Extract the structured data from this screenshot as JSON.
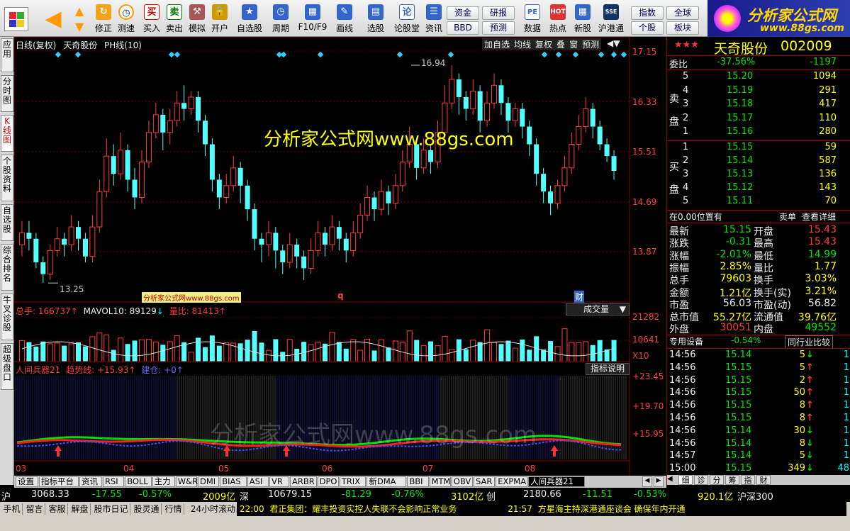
{
  "toolbar": {
    "buttons": [
      "修正",
      "测速",
      "买入",
      "卖出",
      "模拟",
      "开户",
      "自选股",
      "周期",
      "F10/F9",
      "画线",
      "选股",
      "论股堂",
      "资讯",
      "数据",
      "热点",
      "新股",
      "沪港通"
    ],
    "small": [
      "资金",
      "BBD",
      "研报",
      "预测",
      "指数",
      "个股",
      "全球",
      "板块"
    ],
    "logo_text": "分析家公式网",
    "logo_url": "www.88gs.com"
  },
  "vtabs": [
    "应用",
    "分时图",
    "K线图",
    "个股资料",
    "自选股",
    "综合排名",
    "牛叉诊股",
    "超级盘口"
  ],
  "chart": {
    "header": [
      "日线(复权)",
      "天奇股份",
      "PH线(10)"
    ],
    "header_buttons": [
      "加自选",
      "均线",
      "复权",
      "叠",
      "窗",
      "预测"
    ],
    "watermark": "分析家公式网www.88gs.com",
    "watermark_small": "分析家公式网www.88gs.com",
    "watermark_bottom": "分析家公式网www.88gs.com",
    "price_axis": [
      "17.15",
      "16.33",
      "15.51",
      "14.69",
      "13.87"
    ],
    "high_label": "16.94",
    "low_label": "13.25",
    "marker_q": "q",
    "marker_cai": "财",
    "vol_header": {
      "total": "总手: 166737",
      "mavol": "MAVOL10: 89129",
      "ratio": "量比: 81413"
    },
    "vol_button": "成交量",
    "vol_axis": [
      "21282",
      "10641",
      "X10"
    ],
    "ind_header": {
      "name": "人间兵器21",
      "trend": "趋势线: +15.93",
      "build": "建仓: +0"
    },
    "ind_button": "指标说明",
    "ind_axis": [
      "+23.45",
      "+19.70",
      "+15.95"
    ],
    "months": [
      "03",
      "04",
      "05",
      "06",
      "07",
      "08"
    ]
  },
  "chart_data": {
    "type": "candlestick",
    "ylim": [
      13.0,
      17.3
    ],
    "candles": [
      [
        13.9,
        14.1,
        13.7,
        14.3
      ],
      [
        14.1,
        14.0,
        13.8,
        14.3
      ],
      [
        14.0,
        13.6,
        13.5,
        14.1
      ],
      [
        13.6,
        13.4,
        13.25,
        13.7
      ],
      [
        13.4,
        13.8,
        13.3,
        13.9
      ],
      [
        13.8,
        14.0,
        13.7,
        14.2
      ],
      [
        14.0,
        13.9,
        13.7,
        14.1
      ],
      [
        13.9,
        14.2,
        13.8,
        14.4
      ],
      [
        14.2,
        14.0,
        13.8,
        14.3
      ],
      [
        14.0,
        13.7,
        13.6,
        14.1
      ],
      [
        13.7,
        14.2,
        13.6,
        14.4
      ],
      [
        14.2,
        14.8,
        14.1,
        15.0
      ],
      [
        14.8,
        15.4,
        14.7,
        15.7
      ],
      [
        15.4,
        15.1,
        14.9,
        15.6
      ],
      [
        15.1,
        15.5,
        15.0,
        15.8
      ],
      [
        15.5,
        15.0,
        14.8,
        15.6
      ],
      [
        15.0,
        14.7,
        14.5,
        15.2
      ],
      [
        14.7,
        15.3,
        14.6,
        15.5
      ],
      [
        15.3,
        15.8,
        15.2,
        16.0
      ],
      [
        15.8,
        16.1,
        15.7,
        16.3
      ],
      [
        16.1,
        15.8,
        15.5,
        16.2
      ],
      [
        15.8,
        16.0,
        15.6,
        16.2
      ],
      [
        16.0,
        16.3,
        15.9,
        16.5
      ],
      [
        16.3,
        16.2,
        16.0,
        16.6
      ],
      [
        16.2,
        16.4,
        16.1,
        16.5
      ],
      [
        16.4,
        16.0,
        15.8,
        16.5
      ],
      [
        16.0,
        15.6,
        15.4,
        16.1
      ],
      [
        15.6,
        15.0,
        14.8,
        15.7
      ],
      [
        15.0,
        14.7,
        14.5,
        15.1
      ],
      [
        14.7,
        14.9,
        14.6,
        15.1
      ],
      [
        14.9,
        15.2,
        14.8,
        15.4
      ],
      [
        15.2,
        14.9,
        14.6,
        15.3
      ],
      [
        14.9,
        14.5,
        14.3,
        15.0
      ],
      [
        14.5,
        14.0,
        13.8,
        14.6
      ],
      [
        14.0,
        13.9,
        13.6,
        14.1
      ],
      [
        13.9,
        14.1,
        13.7,
        14.3
      ],
      [
        14.1,
        13.8,
        13.5,
        14.2
      ],
      [
        13.8,
        13.6,
        13.4,
        13.9
      ],
      [
        13.6,
        13.9,
        13.5,
        14.1
      ],
      [
        13.9,
        13.7,
        13.5,
        14.0
      ],
      [
        13.7,
        13.5,
        13.3,
        13.8
      ],
      [
        13.5,
        13.8,
        13.4,
        14.0
      ],
      [
        13.8,
        14.1,
        13.7,
        14.3
      ],
      [
        14.1,
        13.9,
        13.7,
        14.2
      ],
      [
        13.9,
        14.2,
        13.8,
        14.4
      ],
      [
        14.2,
        14.0,
        13.8,
        14.3
      ],
      [
        14.0,
        13.8,
        13.6,
        14.1
      ],
      [
        13.8,
        14.1,
        13.7,
        14.3
      ],
      [
        14.1,
        14.4,
        14.0,
        14.6
      ],
      [
        14.4,
        14.7,
        14.3,
        14.9
      ],
      [
        14.7,
        14.5,
        14.3,
        14.8
      ],
      [
        14.5,
        14.8,
        14.4,
        15.0
      ],
      [
        14.8,
        14.6,
        14.4,
        14.9
      ],
      [
        14.6,
        14.9,
        14.5,
        15.1
      ],
      [
        14.9,
        15.3,
        14.8,
        15.5
      ],
      [
        15.3,
        15.6,
        15.2,
        15.9
      ],
      [
        15.6,
        15.2,
        15.0,
        15.7
      ],
      [
        15.2,
        15.5,
        15.1,
        15.7
      ],
      [
        15.5,
        15.3,
        15.1,
        15.6
      ],
      [
        15.3,
        15.8,
        15.2,
        16.0
      ],
      [
        15.8,
        16.3,
        15.7,
        16.6
      ],
      [
        16.3,
        16.7,
        16.2,
        16.94
      ],
      [
        16.7,
        16.4,
        16.1,
        16.8
      ],
      [
        16.4,
        16.2,
        16.0,
        16.5
      ],
      [
        16.2,
        16.5,
        16.1,
        16.7
      ],
      [
        16.5,
        16.0,
        15.8,
        16.6
      ],
      [
        16.0,
        16.3,
        15.9,
        16.5
      ],
      [
        16.3,
        16.6,
        16.2,
        16.8
      ],
      [
        16.6,
        16.3,
        16.1,
        16.7
      ],
      [
        16.3,
        16.0,
        15.8,
        16.4
      ],
      [
        16.0,
        16.2,
        15.9,
        16.3
      ],
      [
        16.2,
        15.9,
        15.7,
        16.3
      ],
      [
        15.9,
        15.6,
        15.4,
        16.0
      ],
      [
        15.6,
        15.1,
        14.9,
        15.7
      ],
      [
        15.1,
        14.8,
        14.6,
        15.2
      ],
      [
        14.8,
        14.6,
        14.4,
        14.9
      ],
      [
        14.6,
        14.9,
        14.5,
        15.0
      ],
      [
        14.9,
        15.2,
        14.8,
        15.4
      ],
      [
        15.2,
        15.6,
        15.1,
        15.8
      ],
      [
        15.6,
        15.9,
        15.5,
        16.1
      ],
      [
        15.9,
        16.2,
        15.8,
        16.4
      ],
      [
        16.2,
        15.9,
        15.7,
        16.3
      ],
      [
        15.9,
        15.6,
        15.5,
        16.0
      ],
      [
        15.6,
        15.4,
        15.3,
        15.7
      ],
      [
        15.4,
        15.15,
        15.0,
        15.5
      ]
    ]
  },
  "right": {
    "stock": "天奇股份",
    "code": "002009",
    "weibi": {
      "label": "委比",
      "pct": "-37.56%",
      "diff": "-1197"
    },
    "sell_label": [
      "卖",
      "盘"
    ],
    "sells": [
      [
        "5",
        "15.20",
        "1094"
      ],
      [
        "4",
        "15.19",
        "291"
      ],
      [
        "3",
        "15.18",
        "417"
      ],
      [
        "2",
        "15.17",
        "110"
      ],
      [
        "1",
        "15.16",
        "280"
      ]
    ],
    "buy_label": [
      "买",
      "盘"
    ],
    "buys": [
      [
        "1",
        "15.15",
        "59"
      ],
      [
        "2",
        "15.14",
        "587"
      ],
      [
        "3",
        "15.13",
        "136"
      ],
      [
        "4",
        "15.12",
        "143"
      ],
      [
        "5",
        "15.11",
        "70"
      ]
    ],
    "position": "在0.00位置有",
    "sell_single": "卖单",
    "detail": "查看详细",
    "quote": [
      [
        "最新",
        "15.15",
        "开盘",
        "15.43"
      ],
      [
        "涨跌",
        "-0.31",
        "最高",
        "15.43"
      ],
      [
        "涨幅",
        "-2.01%",
        "最低",
        "14.99"
      ],
      [
        "振幅",
        "2.85%",
        "量比",
        "1.77"
      ],
      [
        "总手",
        "79603",
        "换手",
        "3.03%"
      ],
      [
        "金额",
        "1.21亿",
        "换手(实)",
        "3.21%"
      ],
      [
        "市盈",
        "56.03",
        "市盈(动)",
        "56.82"
      ],
      [
        "总市值",
        "55.27亿",
        "流通值",
        "39.76亿"
      ],
      [
        "外盘",
        "30051",
        "内盘",
        "49552"
      ]
    ],
    "equip": "专用设备",
    "equip_pct": "-0.54%",
    "compare": "同行业比较",
    "ticks": [
      [
        "14:56",
        "15.14",
        "5",
        "1"
      ],
      [
        "14:56",
        "15.15",
        "5",
        "1"
      ],
      [
        "14:56",
        "15.15",
        "2",
        "1"
      ],
      [
        "14:56",
        "15.15",
        "50",
        "1"
      ],
      [
        "14:56",
        "15.15",
        "8",
        "1"
      ],
      [
        "14:56",
        "15.15",
        "8",
        "1"
      ],
      [
        "14:56",
        "15.14",
        "30",
        "1"
      ],
      [
        "14:56",
        "15.14",
        "8",
        "1"
      ],
      [
        "14:57",
        "15.14",
        "5",
        "1"
      ],
      [
        "15:00",
        "15.15",
        "349",
        "48"
      ]
    ],
    "tabs": [
      "细",
      "诊",
      "分",
      "筹",
      "指",
      "财"
    ]
  },
  "bottom_tabs": [
    "设置",
    "指标平台",
    "资讯",
    "RSI",
    "BOLL",
    "主力",
    "W&R",
    "DMI",
    "BIAS",
    "ASI",
    "VR",
    "ARBR",
    "DPO",
    "TRIX",
    "新DMA",
    "BBI",
    "MTM",
    "OBV",
    "SAR",
    "EXPMA",
    "人间兵器21"
  ],
  "index_bar": {
    "sh": [
      "沪",
      "3068.33",
      "-17.55",
      "-0.57%",
      "2009亿"
    ],
    "sz": [
      "深",
      "10679.15",
      "-81.29",
      "-0.76%",
      "3102亿"
    ],
    "cy": [
      "创",
      "2180.66",
      "-11.51",
      "-0.53%",
      "920.1亿"
    ],
    "hs": "沪深300"
  },
  "status_bar": {
    "items": [
      "手机",
      "留言",
      "客服",
      "解盘",
      "股市日记",
      "股灵通",
      "行情",
      "24小时滚动"
    ],
    "news1_time": "22:00",
    "news1": "君正集团：耀丰投资实控人失联不会影响正常业务",
    "news2_time": "21:57",
    "news2": "方星海主持深港通座谈会 确保年内开通"
  },
  "colors": {
    "up": "#ff3c3c",
    "down": "#54ffff",
    "bg": "#000000",
    "grid": "#800000"
  }
}
